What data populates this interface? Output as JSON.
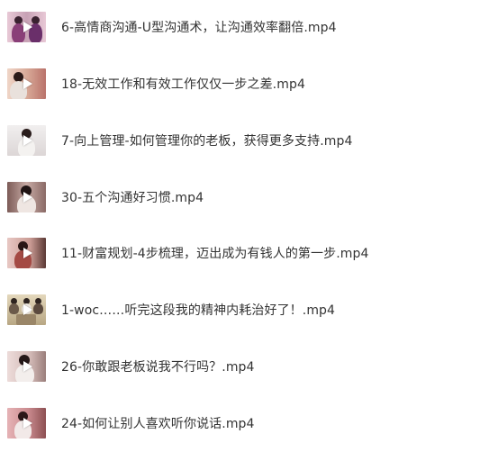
{
  "files": [
    {
      "name": "6-高情商沟通-U型沟通术，让沟通效率翻倍.mp4",
      "thumb_bg": "#c9a6b7",
      "thumb_accent": "#7a3d6b",
      "thumb_icon": "video-thumbnail"
    },
    {
      "name": "18-无效工作和有效工作仅仅一步之差.mp4",
      "thumb_bg": "#d9b7a8",
      "thumb_accent": "#8c4a3e",
      "thumb_icon": "video-thumbnail"
    },
    {
      "name": "7-向上管理-如何管理你的老板，获得更多支持.mp4",
      "thumb_bg": "#e3e0e0",
      "thumb_accent": "#4a3b3a",
      "thumb_icon": "video-thumbnail"
    },
    {
      "name": "30-五个沟通好习惯.mp4",
      "thumb_bg": "#b79a96",
      "thumb_accent": "#3b2a2a",
      "thumb_icon": "video-thumbnail"
    },
    {
      "name": "11-财富规划-4步梳理，迈出成为有钱人的第一步.mp4",
      "thumb_bg": "#d8b6b2",
      "thumb_accent": "#6e2e2a",
      "thumb_icon": "video-thumbnail"
    },
    {
      "name": "1-woc……听完这段我的精神内耗治好了！.mp4",
      "thumb_bg": "#cbbd9e",
      "thumb_accent": "#5a4a3a",
      "thumb_icon": "video-thumbnail"
    },
    {
      "name": "26-你敢跟老板说我不行吗？.mp4",
      "thumb_bg": "#d8c2c0",
      "thumb_accent": "#4d3030",
      "thumb_icon": "video-thumbnail"
    },
    {
      "name": "24-如何让别人喜欢听你说话.mp4",
      "thumb_bg": "#d2a3a6",
      "thumb_accent": "#6a3a3c",
      "thumb_icon": "video-thumbnail"
    }
  ],
  "play_icon": "play-icon"
}
